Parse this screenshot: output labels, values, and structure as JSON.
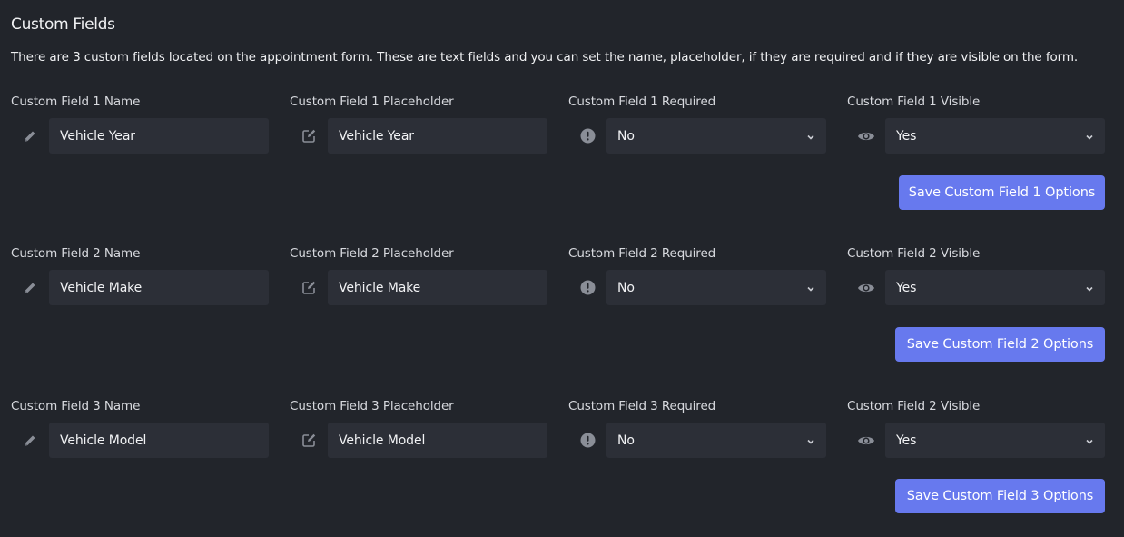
{
  "section": {
    "title": "Custom Fields",
    "description": "There are 3 custom fields located on the appointment form. These are text fields and you can set the name, placeholder, if they are required and if they are visible on the form."
  },
  "fields": [
    {
      "name_label": "Custom Field 1 Name",
      "name_value": "Vehicle Year",
      "placeholder_label": "Custom Field 1 Placeholder",
      "placeholder_value": "Vehicle Year",
      "required_label": "Custom Field 1 Required",
      "required_value": "No",
      "visible_label": "Custom Field 1 Visible",
      "visible_value": "Yes",
      "save_label": "Save Custom Field 1 Options"
    },
    {
      "name_label": "Custom Field 2 Name",
      "name_value": "Vehicle Make",
      "placeholder_label": "Custom Field 2 Placeholder",
      "placeholder_value": "Vehicle Make",
      "required_label": "Custom Field 2 Required",
      "required_value": "No",
      "visible_label": "Custom Field 2 Visible",
      "visible_value": "Yes",
      "save_label": "Save Custom Field 2 Options"
    },
    {
      "name_label": "Custom Field 3 Name",
      "name_value": "Vehicle Model",
      "placeholder_label": "Custom Field 3 Placeholder",
      "placeholder_value": "Vehicle Model",
      "required_label": "Custom Field 3 Required",
      "required_value": "No",
      "visible_label": "Custom Field 2 Visible",
      "visible_value": "Yes",
      "save_label": "Save Custom Field 3 Options"
    }
  ],
  "icons": {
    "name": "pencil-icon",
    "placeholder": "edit-icon",
    "required": "exclamation-circle-icon",
    "visible": "eye-icon",
    "select": "chevron-down-icon"
  },
  "colors": {
    "background": "#22252b",
    "input_background": "#2c2f37",
    "button": "#6779ee",
    "icon": "#8a8e97"
  }
}
